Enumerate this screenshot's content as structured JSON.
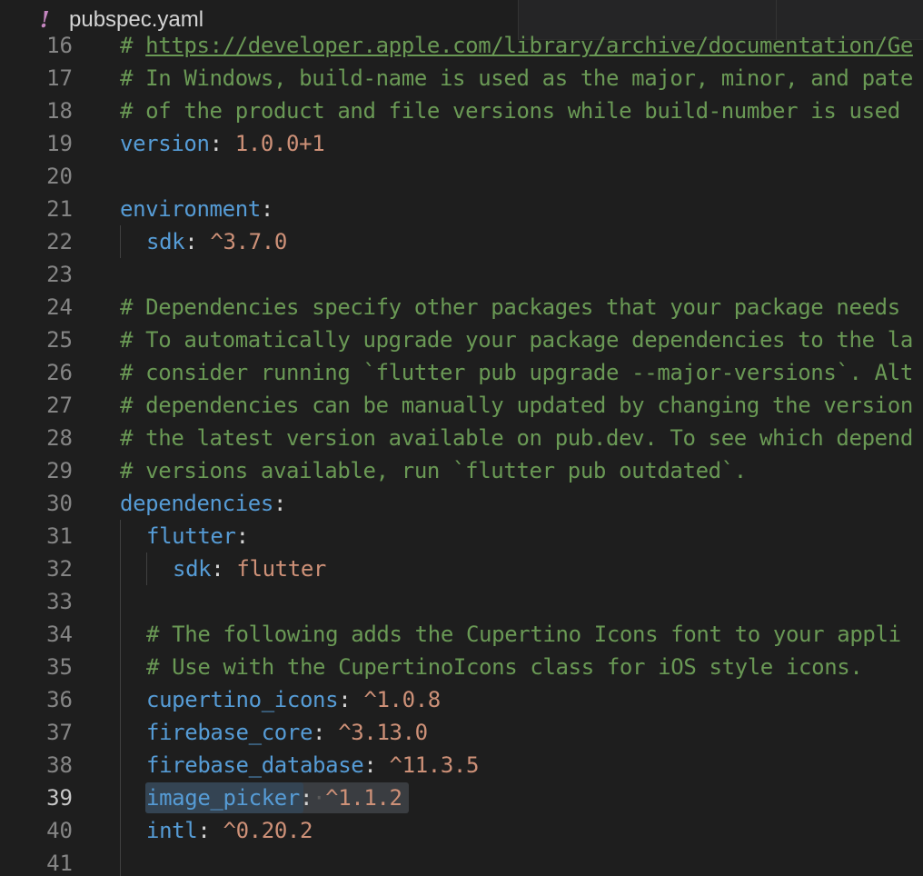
{
  "tab": {
    "icon_glyph": "!",
    "icon_name": "yaml-icon",
    "title": "pubspec.yaml"
  },
  "active_line": 39,
  "lines": [
    {
      "num": "16",
      "indent": 0,
      "parts": [
        {
          "c": "comment",
          "t": "# "
        },
        {
          "c": "link",
          "t": "https://developer.apple.com/library/archive/documentation/Ge"
        }
      ]
    },
    {
      "num": "17",
      "indent": 0,
      "parts": [
        {
          "c": "comment",
          "t": "# In Windows, build-name is used as the major, minor, and pate"
        }
      ]
    },
    {
      "num": "18",
      "indent": 0,
      "parts": [
        {
          "c": "comment",
          "t": "# of the product and file versions while build-number is used"
        }
      ]
    },
    {
      "num": "19",
      "indent": 0,
      "parts": [
        {
          "c": "key",
          "t": "version"
        },
        {
          "c": "punc",
          "t": ": "
        },
        {
          "c": "val",
          "t": "1.0.0+1"
        }
      ]
    },
    {
      "num": "20",
      "indent": 0,
      "parts": []
    },
    {
      "num": "21",
      "indent": 0,
      "parts": [
        {
          "c": "key",
          "t": "environment"
        },
        {
          "c": "punc",
          "t": ":"
        }
      ]
    },
    {
      "num": "22",
      "indent": 1,
      "parts": [
        {
          "c": "key",
          "t": "sdk"
        },
        {
          "c": "punc",
          "t": ": "
        },
        {
          "c": "val",
          "t": "^3.7.0"
        }
      ]
    },
    {
      "num": "23",
      "indent": 0,
      "parts": []
    },
    {
      "num": "24",
      "indent": 0,
      "parts": [
        {
          "c": "comment",
          "t": "# Dependencies specify other packages that your package needs"
        }
      ]
    },
    {
      "num": "25",
      "indent": 0,
      "parts": [
        {
          "c": "comment",
          "t": "# To automatically upgrade your package dependencies to the la"
        }
      ]
    },
    {
      "num": "26",
      "indent": 0,
      "parts": [
        {
          "c": "comment",
          "t": "# consider running `flutter pub upgrade --major-versions`. Alt"
        }
      ]
    },
    {
      "num": "27",
      "indent": 0,
      "parts": [
        {
          "c": "comment",
          "t": "# dependencies can be manually updated by changing the version"
        }
      ]
    },
    {
      "num": "28",
      "indent": 0,
      "parts": [
        {
          "c": "comment",
          "t": "# the latest version available on pub.dev. To see which depend"
        }
      ]
    },
    {
      "num": "29",
      "indent": 0,
      "parts": [
        {
          "c": "comment",
          "t": "# versions available, run `flutter pub outdated`."
        }
      ]
    },
    {
      "num": "30",
      "indent": 0,
      "parts": [
        {
          "c": "key",
          "t": "dependencies"
        },
        {
          "c": "punc",
          "t": ":"
        }
      ]
    },
    {
      "num": "31",
      "indent": 1,
      "parts": [
        {
          "c": "key",
          "t": "flutter"
        },
        {
          "c": "punc",
          "t": ":"
        }
      ]
    },
    {
      "num": "32",
      "indent": 2,
      "parts": [
        {
          "c": "key",
          "t": "sdk"
        },
        {
          "c": "punc",
          "t": ": "
        },
        {
          "c": "val",
          "t": "flutter"
        }
      ]
    },
    {
      "num": "33",
      "indent": 0,
      "parts": []
    },
    {
      "num": "34",
      "indent": 1,
      "parts": [
        {
          "c": "comment",
          "t": "# The following adds the Cupertino Icons font to your appli"
        }
      ]
    },
    {
      "num": "35",
      "indent": 1,
      "parts": [
        {
          "c": "comment",
          "t": "# Use with the CupertinoIcons class for iOS style icons."
        }
      ]
    },
    {
      "num": "36",
      "indent": 1,
      "parts": [
        {
          "c": "key",
          "t": "cupertino_icons"
        },
        {
          "c": "punc",
          "t": ": "
        },
        {
          "c": "val",
          "t": "^1.0.8"
        }
      ]
    },
    {
      "num": "37",
      "indent": 1,
      "parts": [
        {
          "c": "key",
          "t": "firebase_core"
        },
        {
          "c": "punc",
          "t": ": "
        },
        {
          "c": "val",
          "t": "^3.13.0"
        }
      ]
    },
    {
      "num": "38",
      "indent": 1,
      "parts": [
        {
          "c": "key",
          "t": "firebase_database"
        },
        {
          "c": "punc",
          "t": ": "
        },
        {
          "c": "val",
          "t": "^11.3.5"
        }
      ]
    },
    {
      "num": "39",
      "indent": 1,
      "parts": [
        {
          "c": "key",
          "t": "image_picker"
        },
        {
          "c": "punc",
          "t": ":"
        },
        {
          "c": "ws-dot",
          "t": "·"
        },
        {
          "c": "val",
          "t": "^1.1.2"
        }
      ]
    },
    {
      "num": "40",
      "indent": 1,
      "parts": [
        {
          "c": "key",
          "t": "intl"
        },
        {
          "c": "punc",
          "t": ": "
        },
        {
          "c": "val",
          "t": "^0.20.2"
        }
      ]
    },
    {
      "num": "41",
      "indent": 0,
      "parts": []
    }
  ]
}
